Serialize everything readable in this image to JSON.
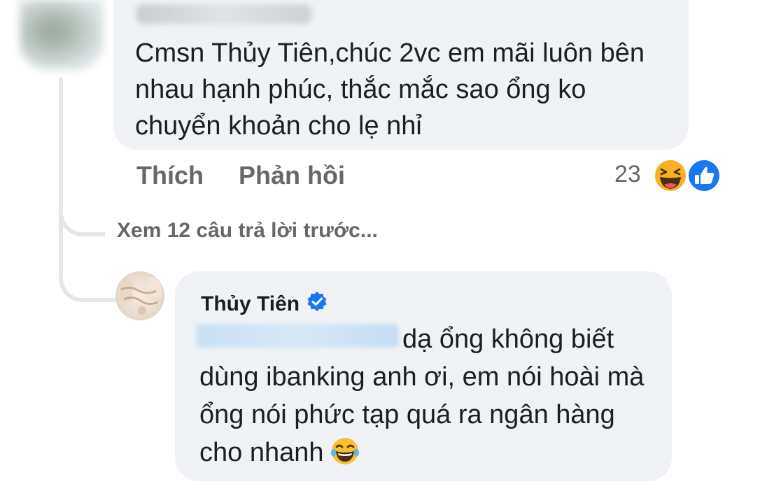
{
  "comment": {
    "text": "Cmsn Thủy Tiên,chúc 2vc em mãi luôn bên nhau hạnh phúc, thắc mắc sao ổng ko chuyển khoản cho lẹ nhỉ",
    "actions": {
      "like_label": "Thích",
      "reply_label": "Phản hồi"
    },
    "reactions": {
      "count": "23",
      "icons": [
        "haha-icon",
        "like-icon"
      ]
    }
  },
  "view_more_replies": "Xem 12 câu trả lời trước...",
  "reply": {
    "author": "Thủy Tiên",
    "verified_icon": "verified-badge-icon",
    "text": "dạ ổng không biết dùng ibanking anh ơi, em nói hoài mà ổng nói phức tạp quá ra ngân hàng cho nhanh",
    "emoji": "tears-of-joy-emoji"
  },
  "colors": {
    "bubble": "#f0f2f5",
    "text": "#1c1e21",
    "secondary_text": "#65676b",
    "verified_blue": "#1877f2",
    "haha_yellow": "#f7b125"
  }
}
